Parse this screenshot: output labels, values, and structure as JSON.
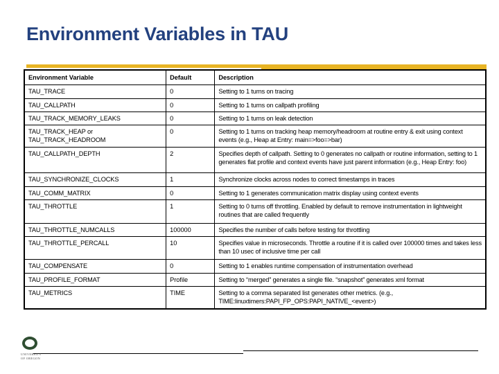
{
  "slide": {
    "title": "Environment Variables in TAU",
    "accent_color": "#e8b424",
    "title_color": "#23417f"
  },
  "table": {
    "headers": {
      "variable": "Environment Variable",
      "default": "Default",
      "description": "Description"
    },
    "rows": [
      {
        "variable": "TAU_TRACE",
        "default": "0",
        "description": "Setting to 1 turns on tracing"
      },
      {
        "variable": "TAU_CALLPATH",
        "default": "0",
        "description": "Setting to 1 turns on callpath profiling"
      },
      {
        "variable": "TAU_TRACK_MEMORY_LEAKS",
        "default": "0",
        "description": "Setting to 1 turns on leak detection"
      },
      {
        "variable": "TAU_TRACK_HEAP or TAU_TRACK_HEADROOM",
        "variable_line1": "TAU_TRACK_HEAP or",
        "variable_line2": "TAU_TRACK_HEADROOM",
        "default": "0",
        "description": "Setting to 1 turns on tracking heap memory/headroom at routine entry & exit using context events (e.g., Heap at Entry: main=>foo=>bar)"
      },
      {
        "variable": "TAU_CALLPATH_DEPTH",
        "default": "2",
        "description": "Specifies depth of callpath. Setting to 0 generates no callpath or routine information, setting to 1 generates flat profile and context events have just parent information (e.g., Heap Entry: foo)"
      },
      {
        "variable": "TAU_SYNCHRONIZE_CLOCKS",
        "default": "1",
        "description": "Synchronize clocks across nodes to correct timestamps in traces"
      },
      {
        "variable": "TAU_COMM_MATRIX",
        "default": "0",
        "description": "Setting to 1 generates communication matrix display using context events"
      },
      {
        "variable": "TAU_THROTTLE",
        "default": "1",
        "description": "Setting to 0 turns off throttling. Enabled by default to remove instrumentation in lightweight routines that are called frequently"
      },
      {
        "variable": "TAU_THROTTLE_NUMCALLS",
        "default": "100000",
        "description": "Specifies the number of calls before testing for throttling"
      },
      {
        "variable": "TAU_THROTTLE_PERCALL",
        "default": "10",
        "description": "Specifies value in microseconds. Throttle a routine if it is called over 100000 times and takes less than 10 usec of inclusive time per call"
      },
      {
        "variable": "TAU_COMPENSATE",
        "default": "0",
        "description": "Setting to 1 enables runtime compensation of instrumentation overhead"
      },
      {
        "variable": "TAU_PROFILE_FORMAT",
        "default": "Profile",
        "description": "Setting to “merged” generates a single file. “snapshot” generates xml format"
      },
      {
        "variable": "TAU_METRICS",
        "default": "TIME",
        "description": "Setting to a comma separated list generates other metrics. (e.g., TIME:linuxtimers:PAPI_FP_OPS:PAPI_NATIVE_<event>)"
      }
    ]
  },
  "footer": {
    "logo_line1": "UNIVERSITY",
    "logo_line2": "OF OREGON",
    "logo_color": "#2f4e32"
  }
}
